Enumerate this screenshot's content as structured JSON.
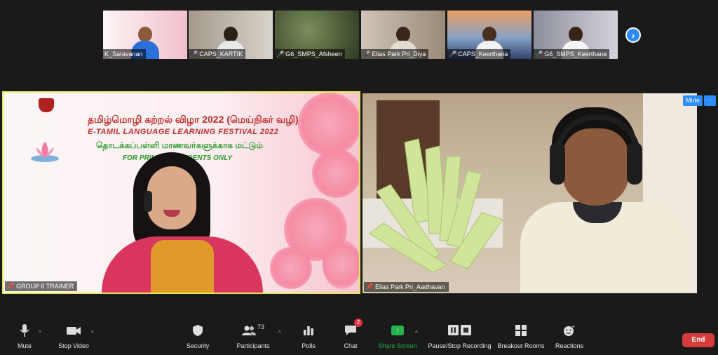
{
  "thumbnails": [
    {
      "name": "K_Saravanan",
      "muted": false,
      "bg": "#f3c9cf"
    },
    {
      "name": "CAPS_KARTIK",
      "muted": true,
      "bg": "#c9c2b6"
    },
    {
      "name": "G6_SMPS_Afsheen",
      "muted": true,
      "bg": "#4c5b3e"
    },
    {
      "name": "Elias Park Pri_Diya",
      "muted": true,
      "bg": "#b8a999"
    },
    {
      "name": "CAPS_Keerthana",
      "muted": true,
      "bg": "#6a7fa6"
    },
    {
      "name": "G6_SMPS_Keerthana",
      "muted": true,
      "bg": "#c2bfc9"
    }
  ],
  "next_arrow": "›",
  "main_left": {
    "name": "GROUP 6 TRAINER",
    "banner": {
      "title_ta": "தமிழ்மொழி கற்றல் விழா 2022 (மெய்நிகர் வழி)",
      "title_en": "E-TAMIL LANGUAGE LEARNING FESTIVAL 2022",
      "sub_ta": "தொடக்கப்பள்ளி மாணவர்களுக்காக மட்டும்",
      "sub_en": "FOR PRIMARY STUDENTS ONLY"
    }
  },
  "main_right": {
    "name": "Elias Park Pri_Aadhavan",
    "mute_label": "Mute",
    "more_label": "···"
  },
  "toolbar": {
    "mute": "Mute",
    "stop_video": "Stop Video",
    "security": "Security",
    "participants": "Participants",
    "participants_count": "73",
    "polls": "Polls",
    "chat": "Chat",
    "chat_badge": "2",
    "share_screen": "Share Screen",
    "recording": "Pause/Stop Recording",
    "breakout": "Breakout Rooms",
    "reactions": "Reactions",
    "end": "End"
  },
  "colors": {
    "accent": "#2d8cff",
    "share_green": "#22b34c",
    "end_red": "#d63b3b",
    "active_speaker": "#e6e65a"
  }
}
